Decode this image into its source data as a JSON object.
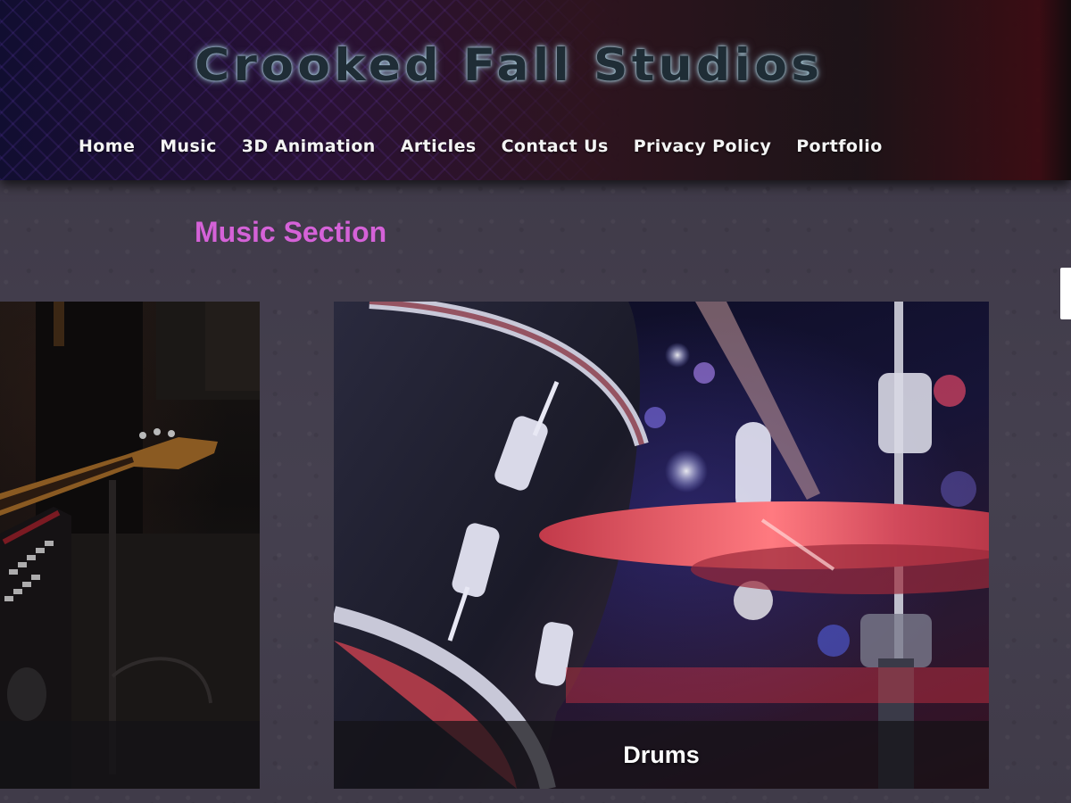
{
  "site": {
    "title": "Crooked Fall Studios"
  },
  "nav": {
    "items": [
      {
        "label": "Home"
      },
      {
        "label": "Music"
      },
      {
        "label": "3D Animation"
      },
      {
        "label": "Articles"
      },
      {
        "label": "Contact Us"
      },
      {
        "label": "Privacy Policy"
      },
      {
        "label": "Portfolio"
      }
    ]
  },
  "section": {
    "title": "Music Section"
  },
  "cards": [
    {
      "caption": "",
      "image": "guitar-photo"
    },
    {
      "caption": "Drums",
      "image": "drums-photo"
    }
  ],
  "colors": {
    "section_title": "#d562d8",
    "nav_text": "#f4f4f4",
    "page_background": "#3f3a48"
  }
}
